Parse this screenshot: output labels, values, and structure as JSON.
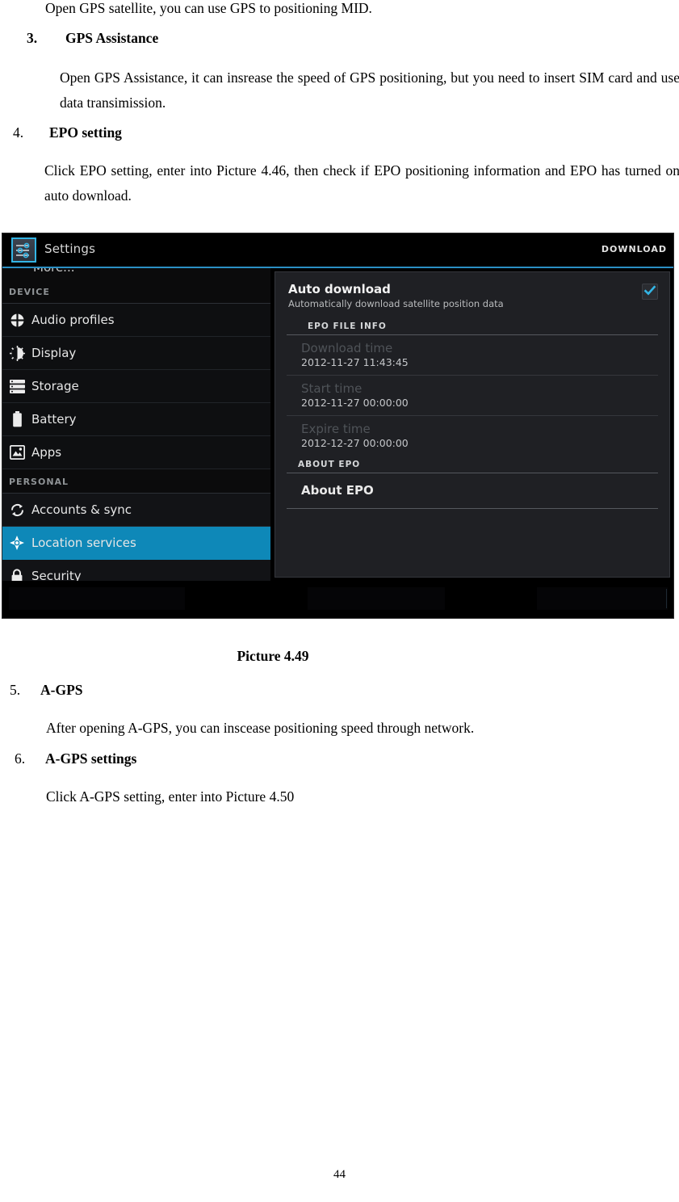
{
  "document": {
    "page_number": "44",
    "caption": "Picture 4.49",
    "blocks": [
      {
        "type": "paragraph",
        "text": "Open GPS satellite, you can use GPS to positioning MID."
      },
      {
        "type": "numbered_heading",
        "number": "3.",
        "label": "GPS Assistance"
      },
      {
        "type": "paragraph",
        "text": "Open GPS Assistance, it can insrease the speed of GPS positioning, but you need to insert SIM card and use data transimission."
      },
      {
        "type": "numbered_heading",
        "number": "4.",
        "label": "EPO setting"
      },
      {
        "type": "paragraph",
        "text": "Click EPO setting, enter into Picture 4.46, then check if EPO positioning information and EPO has turned on auto download."
      },
      {
        "type": "numbered_heading",
        "number": "5.",
        "label": "A-GPS"
      },
      {
        "type": "paragraph",
        "text": "After opening A-GPS, you can inscease positioning speed through network."
      },
      {
        "type": "numbered_heading",
        "number": "6.",
        "label": "A-GPS settings"
      },
      {
        "type": "paragraph",
        "text": "Click A-GPS setting, enter into Picture 4.50"
      }
    ]
  },
  "screenshot": {
    "action_bar": {
      "app_icon": "settings-sliders-icon",
      "title": "Settings",
      "action_label": "DOWNLOAD"
    },
    "sidebar": {
      "partial_top_item": "More...",
      "groups": [
        {
          "header": "DEVICE",
          "items": [
            {
              "label": "Audio profiles",
              "icon": "audio-profiles-icon",
              "selected": false
            },
            {
              "label": "Display",
              "icon": "display-brightness-icon",
              "selected": false
            },
            {
              "label": "Storage",
              "icon": "storage-icon",
              "selected": false
            },
            {
              "label": "Battery",
              "icon": "battery-icon",
              "selected": false
            },
            {
              "label": "Apps",
              "icon": "apps-icon",
              "selected": false
            }
          ]
        },
        {
          "header": "PERSONAL",
          "items": [
            {
              "label": "Accounts & sync",
              "icon": "sync-icon",
              "selected": false
            },
            {
              "label": "Location services",
              "icon": "location-crosshair-icon",
              "selected": true
            },
            {
              "label": "Security",
              "icon": "lock-icon",
              "selected": false
            }
          ]
        }
      ]
    },
    "content": {
      "auto_download": {
        "title": "Auto download",
        "summary": "Automatically download satellite position data",
        "checked": true
      },
      "epo_file_info": {
        "section_label": "EPO FILE INFO",
        "rows": [
          {
            "label": "Download time",
            "value": "2012-11-27 11:43:45"
          },
          {
            "label": "Start time",
            "value": "2012-11-27 00:00:00"
          },
          {
            "label": "Expire time",
            "value": "2012-12-27 00:00:00"
          }
        ]
      },
      "about_epo": {
        "section_label": "ABOUT EPO",
        "item_label": "About EPO"
      }
    },
    "colors": {
      "accent": "#33b5e5",
      "selected_row": "#0e88b8",
      "panel_bg": "#1f2024",
      "sidebar_bg": "#121316",
      "action_bar_bg": "#000000"
    }
  }
}
